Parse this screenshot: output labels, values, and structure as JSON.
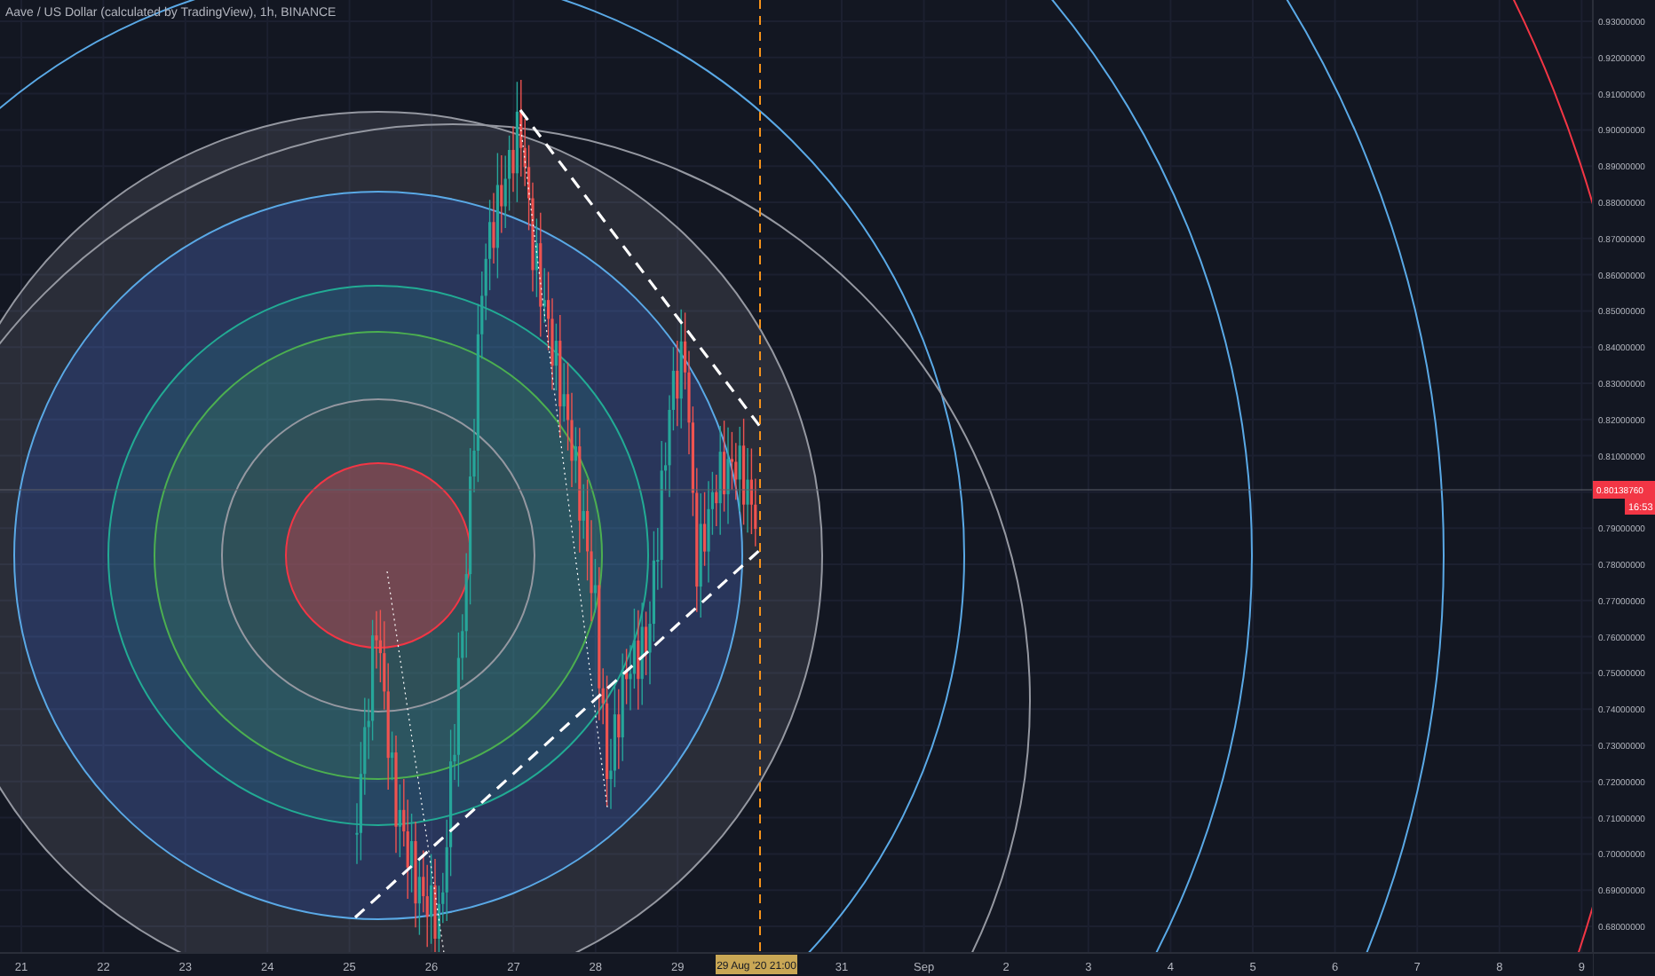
{
  "title": "Aave / US Dollar (calculated by TradingView), 1h, BINANCE",
  "price_axis": {
    "labels_above": [
      "0.93000000",
      "0.92000000",
      "0.91000000",
      "0.90000000",
      "0.89000000",
      "0.88000000",
      "0.87000000",
      "0.86000000",
      "0.85000000",
      "0.84000000",
      "0.83000000",
      "0.82000000",
      "0.81000000"
    ],
    "labels_below": [
      "0.79000000",
      "0.78000000",
      "0.77000000",
      "0.76000000",
      "0.75000000",
      "0.74000000",
      "0.73000000",
      "0.72000000",
      "0.71000000",
      "0.70000000",
      "0.69000000",
      "0.68000000"
    ],
    "last_price": "0.80138760",
    "countdown": "16:53"
  },
  "time_axis": {
    "labels": [
      "21",
      "22",
      "23",
      "24",
      "25",
      "26",
      "27",
      "28",
      "29",
      "31",
      "Sep",
      "2",
      "3",
      "4",
      "5",
      "6",
      "7",
      "8",
      "9"
    ],
    "crosshair_label": "29 Aug '20  21:00"
  }
}
